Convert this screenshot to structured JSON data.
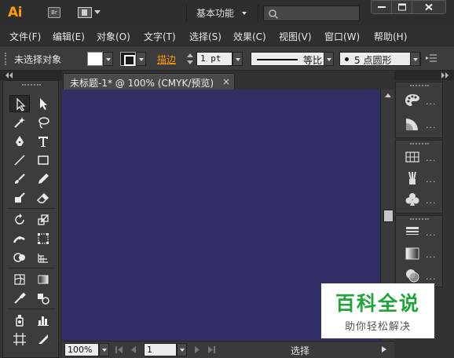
{
  "app": {
    "logo": "Ai",
    "bridge_label": "Br",
    "workspace": "基本功能",
    "search_placeholder": ""
  },
  "menu": [
    "文件(F)",
    "编辑(E)",
    "对象(O)",
    "文字(T)",
    "选择(S)",
    "效果(C)",
    "视图(V)",
    "窗口(W)",
    "帮助(H)"
  ],
  "control_bar": {
    "selection_status": "未选择对象",
    "stroke_label": "描边",
    "stroke_weight": "1 pt",
    "profile_label": "等比",
    "brush_label": "5 点圆形",
    "fill_color": "#ffffff",
    "stroke_color": "#000000"
  },
  "document": {
    "tab_title": "未标题-1* @ 100% (CMYK/预览)",
    "close_glyph": "×",
    "canvas_color": "#322f67"
  },
  "status_bar": {
    "zoom": "100%",
    "page": "1",
    "tool_status": "选择"
  },
  "watermark": {
    "title": "百科全说",
    "subtitle": "助你轻松解决"
  },
  "right_panel_dots": "..."
}
